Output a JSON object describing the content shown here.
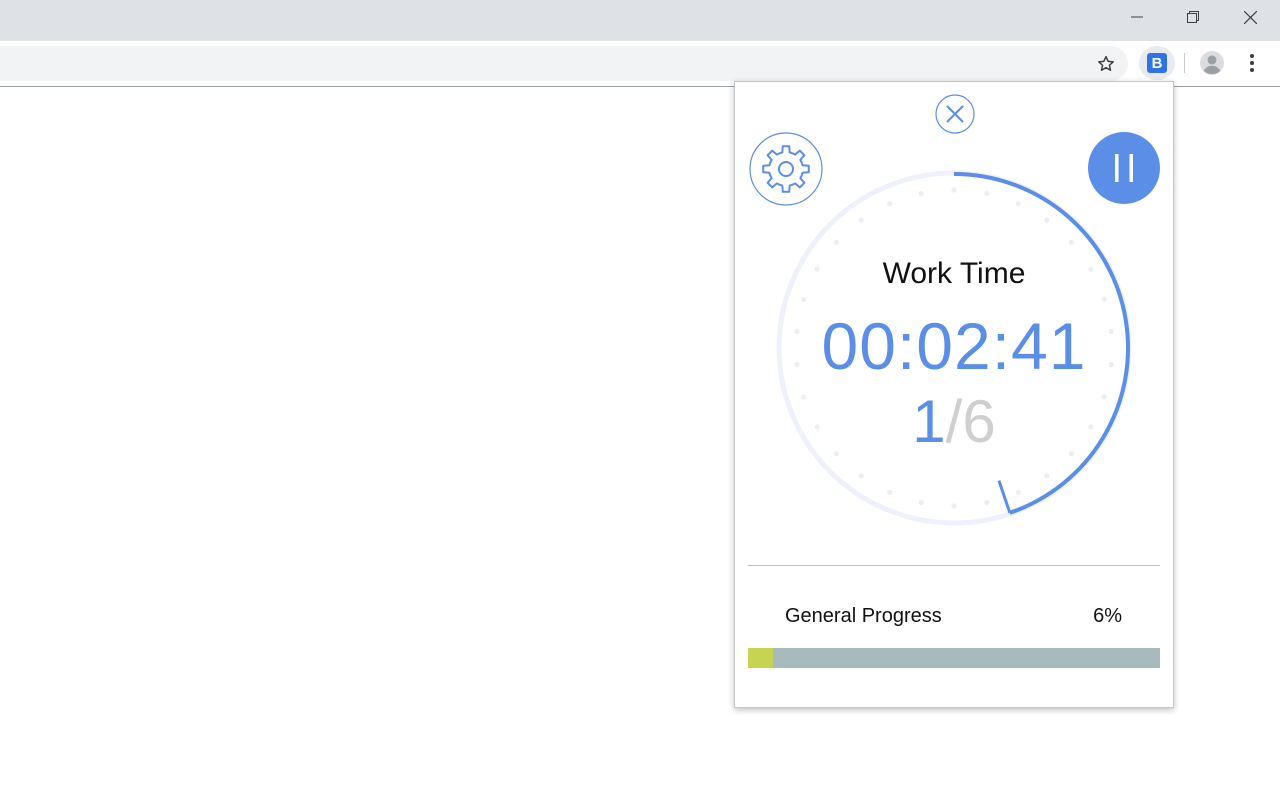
{
  "window": {
    "controls": [
      "minimize-icon",
      "restore-icon",
      "close-icon"
    ]
  },
  "toolbar": {
    "icons": [
      "star-icon",
      "extension-icon",
      "profile-icon",
      "menu-icon"
    ],
    "extension_letter": "B",
    "extension_color": "#2e74e6"
  },
  "popup": {
    "mode_title": "Work Time",
    "timer": "00:02:41",
    "session_current": "1",
    "session_total": "/6",
    "progress_label": "General Progress",
    "progress_percent_text": "6%",
    "progress_fraction": 0.06,
    "dial_elapsed_fraction": 0.448,
    "colors": {
      "accent": "#5b8ee6",
      "progress_fill": "#c7d451",
      "progress_track": "#a8babe"
    }
  }
}
